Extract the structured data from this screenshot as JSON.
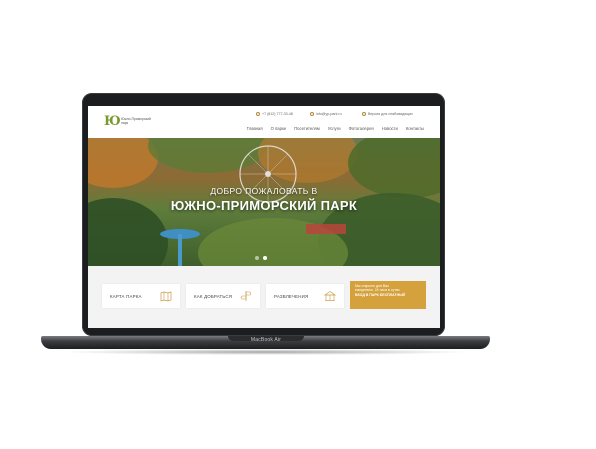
{
  "device": {
    "label": "MacBook Air"
  },
  "site": {
    "logo": {
      "mark": "Ю",
      "text": "Южно-Приморский парк"
    },
    "phone": "+7 (812) 777-33-48",
    "email": "info@yp-park.ru",
    "accessibility": "Версия для слабовидящих",
    "nav": [
      "Главная",
      "О парке",
      "Посетителям",
      "Услуги",
      "Фотогалерея",
      "Новости",
      "Контакты"
    ]
  },
  "hero": {
    "title_line1": "ДОБРО ПОЖАЛОВАТЬ В",
    "title_line2": "ЮЖНО-ПРИМОРСКИЙ ПАРК",
    "slide_count": 2,
    "active_slide": 2
  },
  "cards": [
    {
      "label": "КАРТА ПАРКА",
      "icon": "map-icon"
    },
    {
      "label": "КАК ДОБРАТЬСЯ",
      "icon": "directions-icon"
    },
    {
      "label": "РАЗВЛЕЧЕНИЯ",
      "icon": "carousel-icon"
    }
  ],
  "promo": {
    "line1": "Мы открыты для Вас",
    "line2": "ежедневно, 24 часа в сутки",
    "line3": "ВХОД В ПАРК БЕСПЛАТНЫЙ"
  },
  "colors": {
    "accent": "#d5a13c",
    "logo_green": "#7a9a2e",
    "frame": "#1c1d1f"
  }
}
